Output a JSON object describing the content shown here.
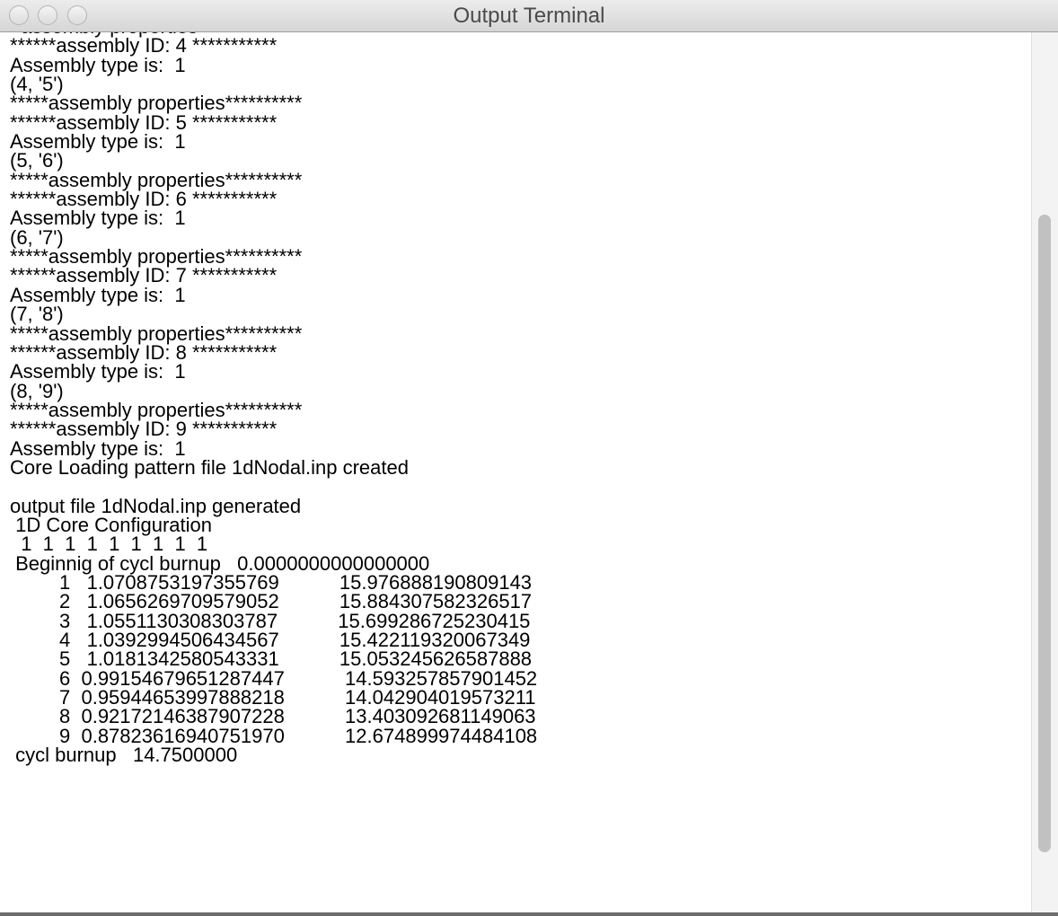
{
  "window": {
    "title": "Output Terminal"
  },
  "terminal": {
    "lines": [
      "  assembly properties",
      "******assembly ID: 4 ***********",
      "Assembly type is:  1",
      "(4, '5')",
      "*****assembly properties**********",
      "******assembly ID: 5 ***********",
      "Assembly type is:  1",
      "(5, '6')",
      "*****assembly properties**********",
      "******assembly ID: 6 ***********",
      "Assembly type is:  1",
      "(6, '7')",
      "*****assembly properties**********",
      "******assembly ID: 7 ***********",
      "Assembly type is:  1",
      "(7, '8')",
      "*****assembly properties**********",
      "******assembly ID: 8 ***********",
      "Assembly type is:  1",
      "(8, '9')",
      "*****assembly properties**********",
      "******assembly ID: 9 ***********",
      "Assembly type is:  1",
      "Core Loading pattern file 1dNodal.inp created",
      "",
      "output file 1dNodal.inp generated",
      " 1D Core Configuration",
      "  1  1  1  1  1  1  1  1  1",
      " Beginnig of cycl burnup   0.0000000000000000",
      "         1   1.0708753197355769           15.976888190809143",
      "         2   1.0656269709579052           15.884307582326517",
      "         3   1.0551130308303787           15.699286725230415",
      "         4   1.0392994506434567           15.422119320067349",
      "         5   1.0181342580543331           15.053245626587888",
      "         6  0.99154679651287447           14.593257857901452",
      "         7  0.95944653997888218           14.042904019573211",
      "         8  0.92172146387907228           13.403092681149063",
      "         9  0.87823616940751970           12.674899974484108",
      " cycl burnup   14.7500000"
    ]
  },
  "scrollbar": {
    "position": 0.76,
    "visible_fraction": 0.73
  }
}
